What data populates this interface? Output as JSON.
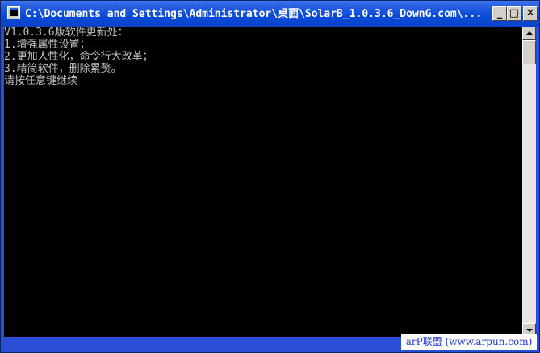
{
  "window": {
    "title": "C:\\Documents and Settings\\Administrator\\桌面\\SolarB_1.0.3.6_DownG.com\\...",
    "buttons": {
      "minimize": "_",
      "maximize": "□",
      "close": "✕"
    }
  },
  "console": {
    "lines": [
      "V1.0.3.6版软件更新处：",
      "1.增强属性设置；",
      "2.更加人性化，命令行大改革；",
      "3.精简软件，删除累赘。",
      "请按任意键继续"
    ]
  },
  "watermark": "arP联盟 (www.arpun.com)",
  "icons": {
    "app": "console-app-icon",
    "scroll_up": "arrow-up-icon",
    "scroll_down": "arrow-down-icon"
  },
  "colors": {
    "title_bar": "#0a4ad8",
    "console_bg": "#000000",
    "console_text": "#c0c0c0",
    "watermark": "#1d3ad1"
  }
}
